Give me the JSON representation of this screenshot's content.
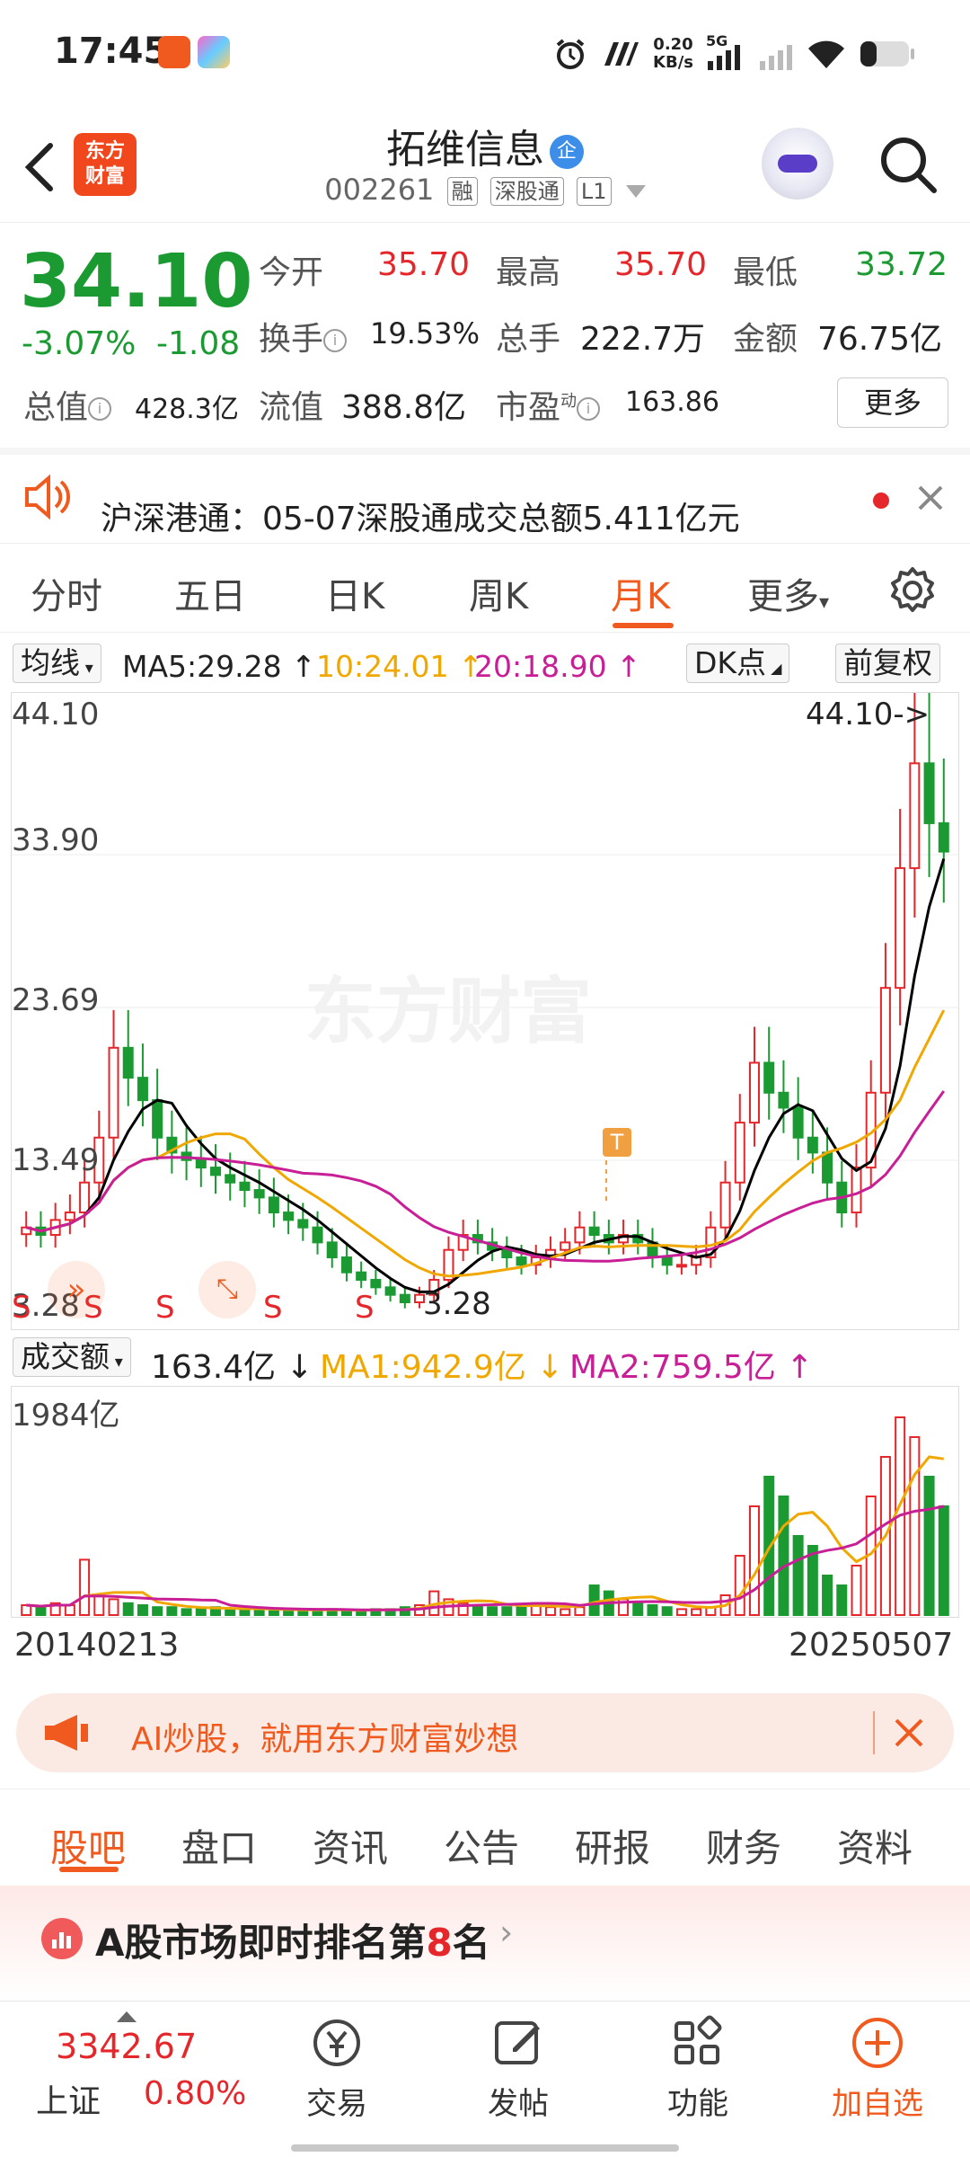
{
  "status_bar": {
    "time": "17:45",
    "net_speed_value": "0.20",
    "net_speed_unit": "KB/s",
    "network": "5G"
  },
  "header": {
    "logo_line1": "东方",
    "logo_line2": "财富",
    "stock_name": "拓维信息",
    "enterprise_badge": "企",
    "stock_code": "002261",
    "tags": [
      "融",
      "深股通",
      "L1"
    ]
  },
  "quote": {
    "price": "34.10",
    "change_pct": "-3.07%",
    "change_abs": "-1.08",
    "open_label": "今开",
    "open_value": "35.70",
    "high_label": "最高",
    "high_value": "35.70",
    "low_label": "最低",
    "low_value": "33.72",
    "turnover_label": "换手",
    "turnover_value": "19.53%",
    "volume_label": "总手",
    "volume_value": "222.7万",
    "amount_label": "金额",
    "amount_value": "76.75亿",
    "total_cap_label": "总值",
    "total_cap_value": "428.3亿",
    "float_cap_label": "流值",
    "float_cap_value": "388.8亿",
    "pe_label": "市盈",
    "pe_sup": "动",
    "pe_value": "163.86",
    "more_label": "更多"
  },
  "notice": {
    "text": "沪深港通：05-07深股通成交总额5.411亿元"
  },
  "period_tabs": [
    "分时",
    "五日",
    "日K",
    "周K",
    "月K",
    "更多"
  ],
  "active_tab": "月K",
  "ma_bar": {
    "indicator": "均线",
    "ma5": "MA5:29.28 ↑",
    "ma10": "10:24.01 ↑",
    "ma20": "20:18.90 ↑",
    "dk": "DK点",
    "adjust": "前复权"
  },
  "chart_data": {
    "type": "candlestick",
    "period": "monthly",
    "y_labels": [
      "44.10",
      "33.90",
      "23.69",
      "13.49",
      "3.28"
    ],
    "max_marker": "44.10->",
    "min_marker": "3.28",
    "watermark": "东方财富",
    "signal_markers": [
      "S",
      "S",
      "S",
      "S",
      "S"
    ],
    "t_marker": "T",
    "x_start": "20140213",
    "x_end": "20250507",
    "close_series": [
      9,
      8.5,
      9.5,
      10,
      12,
      15,
      21,
      19,
      17.5,
      15,
      14,
      13.5,
      13,
      12.5,
      12,
      11.5,
      11,
      10,
      9.5,
      9,
      8,
      7,
      6,
      5.5,
      5,
      4.5,
      4,
      4.5,
      5.5,
      7.5,
      8.5,
      8,
      7.5,
      7,
      6.5,
      7,
      7.5,
      8,
      9,
      8.5,
      8,
      8.5,
      8,
      7,
      6.5,
      6.5,
      7,
      9,
      12,
      16,
      20,
      18,
      17,
      15,
      14,
      12,
      10,
      13,
      18,
      25,
      33,
      40,
      36,
      34.1
    ],
    "ma5": {
      "name": "MA5",
      "color": "#000000"
    },
    "ma10": {
      "name": "MA10",
      "color": "#f0a800"
    },
    "ma20": {
      "name": "MA20",
      "color": "#c81e96"
    }
  },
  "volume_bar": {
    "indicator": "成交额",
    "value": "163.4亿 ↓",
    "ma1": "MA1:942.9亿 ↓",
    "ma2": "MA2:759.5亿 ↑",
    "max_label": "1984亿",
    "volume_series": [
      5,
      4,
      6,
      5,
      28,
      10,
      8,
      6,
      5,
      4,
      4,
      3,
      3,
      4,
      3,
      3,
      3,
      2,
      3,
      2,
      3,
      3,
      2,
      2,
      3,
      3,
      4,
      5,
      12,
      8,
      6,
      5,
      4,
      4,
      5,
      6,
      4,
      3,
      4,
      15,
      12,
      8,
      6,
      5,
      4,
      3,
      3,
      4,
      10,
      30,
      55,
      70,
      60,
      40,
      35,
      20,
      15,
      25,
      60,
      80,
      100,
      90,
      70,
      55
    ]
  },
  "date_start": "20140213",
  "date_end": "20250507",
  "ai_banner": {
    "text": "AI炒股，就用东方财富妙想"
  },
  "bottom_tabs": [
    "股吧",
    "盘口",
    "资讯",
    "公告",
    "研报",
    "财务",
    "资料"
  ],
  "rank": {
    "prefix": "A股市场即时排名第",
    "number": "8",
    "suffix": "名"
  },
  "bottom_nav": {
    "index_value": "3342.67",
    "index_name": "上证",
    "index_change": "0.80%",
    "trade": "交易",
    "post": "发帖",
    "function": "功能",
    "add_watch": "加自选"
  },
  "colors": {
    "accent": "#f05a1e",
    "up": "#e5262a",
    "down": "#1b9a32"
  }
}
